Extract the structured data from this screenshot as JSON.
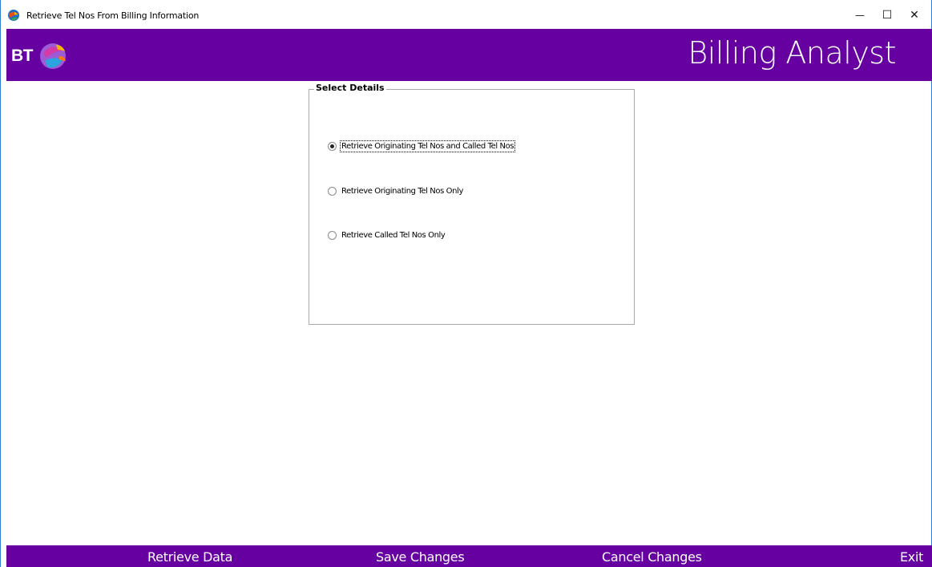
{
  "window": {
    "title": "Retrieve Tel Nos From Billing Information",
    "minimize_glyph": "—",
    "maximize_glyph": "☐",
    "close_glyph": "✕"
  },
  "header": {
    "logo_text": "BT",
    "app_title": "Billing Analyst",
    "brand_color": "#6600a0"
  },
  "details": {
    "legend": "Select Details",
    "options": [
      {
        "label": "Retrieve Originating Tel Nos and Called Tel Nos",
        "checked": true
      },
      {
        "label": "Retrieve Originating Tel Nos Only",
        "checked": false
      },
      {
        "label": "Retrieve Called Tel Nos Only",
        "checked": false
      }
    ]
  },
  "footer": {
    "retrieve": "Retrieve Data",
    "save": "Save Changes",
    "cancel": "Cancel Changes",
    "exit": "Exit"
  },
  "icons": {
    "app": "bt-globe-icon",
    "logo": "bt-piper-logo"
  }
}
